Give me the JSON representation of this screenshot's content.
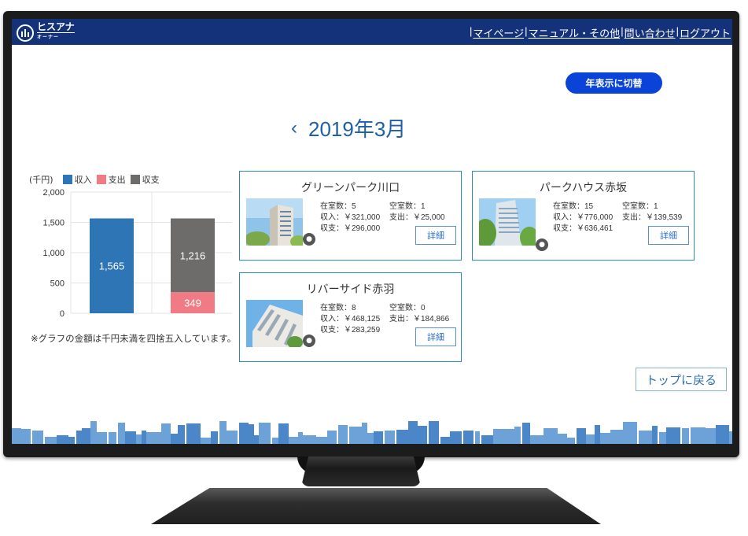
{
  "header": {
    "logo_text": "ヒスアナ",
    "logo_sub": "オーナー",
    "nav": [
      "マイページ",
      "マニュアル・その他",
      "問い合わせ",
      "ログアウト"
    ]
  },
  "toggle_label": "年表示に切替",
  "period": {
    "prev_glyph": "‹",
    "label": "2019年3月"
  },
  "chart_data": {
    "type": "bar",
    "unit_label": "(千円)",
    "ylim": [
      0,
      2000
    ],
    "yticks": [
      "2,000",
      "1,500",
      "1,000",
      "500",
      "0"
    ],
    "legend": [
      "収入",
      "支出",
      "収支"
    ],
    "colors": {
      "income": "#2e75b6",
      "expense": "#f07b84",
      "balance": "#6e6b6b"
    },
    "bars": [
      {
        "series": "収入",
        "value": 1565,
        "label": "1,565"
      },
      {
        "series": "収支",
        "stack": [
          {
            "name": "支出",
            "value": 349,
            "label": "349"
          },
          {
            "name": "収支",
            "value": 1216,
            "label": "1,216"
          }
        ]
      }
    ]
  },
  "chart_note": "※グラフの金額は千円未満を四捨五入しています。",
  "properties": [
    {
      "name": "グリーンパーク川口",
      "occupied": "在室数：5",
      "vacant": "空室数：1",
      "income": "収入：￥321,000",
      "expense": "支出：￥25,000",
      "balance": "収支：￥296,000",
      "detail_label": "詳細"
    },
    {
      "name": "パークハウス赤坂",
      "occupied": "在室数：15",
      "vacant": "空室数：1",
      "income": "収入：￥776,000",
      "expense": "支出：￥139,539",
      "balance": "収支：￥636,461",
      "detail_label": "詳細"
    },
    {
      "name": "リバーサイド赤羽",
      "occupied": "在室数：8",
      "vacant": "空室数：0",
      "income": "収入：￥468,125",
      "expense": "支出：￥184,866",
      "balance": "収支：￥283,259",
      "detail_label": "詳細"
    }
  ],
  "back_label": "トップに戻る",
  "icons": {
    "camera": "camera-icon"
  }
}
